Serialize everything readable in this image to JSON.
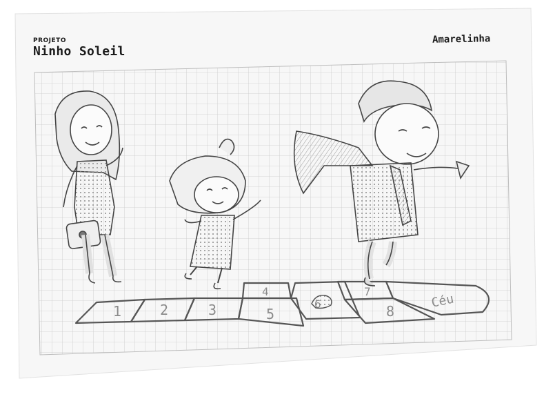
{
  "header": {
    "kicker": "PROJETO",
    "brand": "Ninho Soleil",
    "title": "Amarelinha"
  },
  "hopscotch": {
    "squares": [
      "1",
      "2",
      "3",
      "4",
      "5",
      "6",
      "7",
      "8"
    ],
    "home": "Céu"
  }
}
